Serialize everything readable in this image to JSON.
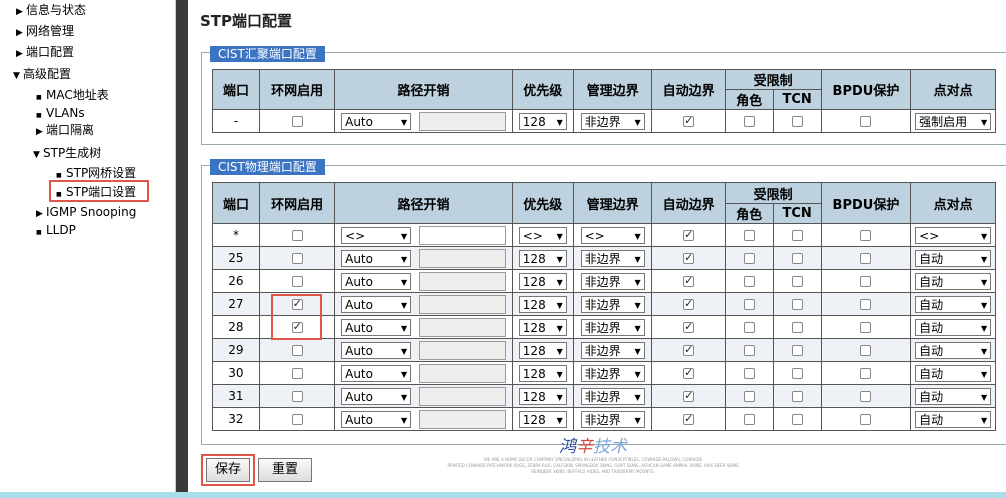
{
  "sidebar": {
    "items": [
      {
        "label": "信息与状态",
        "caret": "▶"
      },
      {
        "label": "网络管理",
        "caret": "▶"
      },
      {
        "label": "端口配置",
        "caret": "▶"
      },
      {
        "label": "高级配置",
        "caret": "▼"
      },
      {
        "label": "MAC地址表",
        "caret": "■"
      },
      {
        "label": "VLANs",
        "caret": "■"
      },
      {
        "label": "端口隔离",
        "caret": "▶"
      },
      {
        "label": "STP生成树",
        "caret": "▼"
      },
      {
        "label": "STP网桥设置",
        "caret": "■"
      },
      {
        "label": "STP端口设置",
        "caret": "■"
      },
      {
        "label": "IGMP Snooping",
        "caret": "▶"
      },
      {
        "label": "LLDP",
        "caret": "■"
      }
    ]
  },
  "page": {
    "title": "STP端口配置"
  },
  "columns": {
    "port": "端口",
    "stp_enabled": "环网启用",
    "path_cost": "路径开销",
    "priority": "优先级",
    "admin_edge": "管理边界",
    "auto_edge": "自动边界",
    "restricted": "受限制",
    "role": "角色",
    "tcn": "TCN",
    "bpdu_guard": "BPDU保护",
    "p2p": "点对点"
  },
  "cist_aggr": {
    "title": "CIST汇聚端口配置",
    "row": {
      "port": "-",
      "enabled": false,
      "path_cost": "Auto",
      "priority": "128",
      "admin_edge": "非边界",
      "auto_edge": true,
      "role": false,
      "tcn": false,
      "bpdu": false,
      "p2p": "强制启用"
    }
  },
  "cist_phys": {
    "title": "CIST物理端口配置",
    "rows": [
      {
        "port": "*",
        "enabled": false,
        "path_cost": "<>",
        "priority": "<>",
        "admin_edge": "<>",
        "auto_edge": true,
        "role": false,
        "tcn": false,
        "bpdu": false,
        "p2p": "<>",
        "cost_white": true
      },
      {
        "port": "25",
        "enabled": false,
        "path_cost": "Auto",
        "priority": "128",
        "admin_edge": "非边界",
        "auto_edge": true,
        "role": false,
        "tcn": false,
        "bpdu": false,
        "p2p": "自动"
      },
      {
        "port": "26",
        "enabled": false,
        "path_cost": "Auto",
        "priority": "128",
        "admin_edge": "非边界",
        "auto_edge": true,
        "role": false,
        "tcn": false,
        "bpdu": false,
        "p2p": "自动"
      },
      {
        "port": "27",
        "enabled": true,
        "path_cost": "Auto",
        "priority": "128",
        "admin_edge": "非边界",
        "auto_edge": true,
        "role": false,
        "tcn": false,
        "bpdu": false,
        "p2p": "自动"
      },
      {
        "port": "28",
        "enabled": true,
        "path_cost": "Auto",
        "priority": "128",
        "admin_edge": "非边界",
        "auto_edge": true,
        "role": false,
        "tcn": false,
        "bpdu": false,
        "p2p": "自动"
      },
      {
        "port": "29",
        "enabled": false,
        "path_cost": "Auto",
        "priority": "128",
        "admin_edge": "非边界",
        "auto_edge": true,
        "role": false,
        "tcn": false,
        "bpdu": false,
        "p2p": "自动"
      },
      {
        "port": "30",
        "enabled": false,
        "path_cost": "Auto",
        "priority": "128",
        "admin_edge": "非边界",
        "auto_edge": true,
        "role": false,
        "tcn": false,
        "bpdu": false,
        "p2p": "自动"
      },
      {
        "port": "31",
        "enabled": false,
        "path_cost": "Auto",
        "priority": "128",
        "admin_edge": "非边界",
        "auto_edge": true,
        "role": false,
        "tcn": false,
        "bpdu": false,
        "p2p": "自动"
      },
      {
        "port": "32",
        "enabled": false,
        "path_cost": "Auto",
        "priority": "128",
        "admin_edge": "非边界",
        "auto_edge": true,
        "role": false,
        "tcn": false,
        "bpdu": false,
        "p2p": "自动"
      }
    ]
  },
  "buttons": {
    "save": "保存",
    "reset": "重置"
  },
  "watermark": {
    "logo_a": "鸿",
    "logo_b": "辛",
    "logo_c": "技术",
    "lines": [
      "WE ARE A HOME DECOR COMPANY SPECIALIZING IN LEATHER CONVERTIBLES, COWHIDE PILLOWS, COWHIDE",
      "PRINTED COWHIDE PATCHWORK RUGS, ZEBRA RUG, CALFSKIN, SPRINGBOK SKINS, GOAT SKINS, AFRICAN GAME ANIMAL SKINS, AXIS DEER SKINS",
      "REINDEER SKINS, BUFFALO HIDES, AND TAXIDERMY MOUNTS."
    ]
  },
  "colors": {
    "panel_header": "#3c74c4",
    "table_header": "#bdd1de",
    "highlight": "#e0564a",
    "divider": "#3a3a3a"
  }
}
